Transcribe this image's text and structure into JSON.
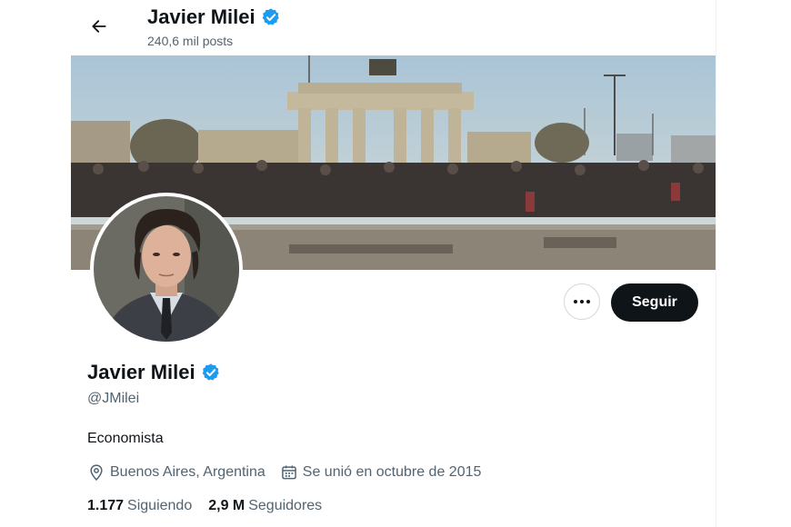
{
  "header": {
    "name": "Javier Milei",
    "posts": "240,6 mil posts"
  },
  "profile": {
    "name": "Javier Milei",
    "handle": "@JMilei",
    "bio": "Economista",
    "location": "Buenos Aires, Argentina",
    "joined": "Se unió en octubre de 2015",
    "following_count": "1.177",
    "following_label": "Siguiendo",
    "followers_count": "2,9 M",
    "followers_label": "Seguidores"
  },
  "actions": {
    "follow_label": "Seguir"
  },
  "icons": {
    "back": "arrow-left-icon",
    "verified": "verified-badge-icon",
    "more": "more-horizontal-icon",
    "location": "location-pin-icon",
    "calendar": "calendar-icon"
  },
  "colors": {
    "verified": "#1d9bf0",
    "primary_text": "#0f1419",
    "secondary_text": "#536471",
    "follow_button": "#0f1419"
  }
}
